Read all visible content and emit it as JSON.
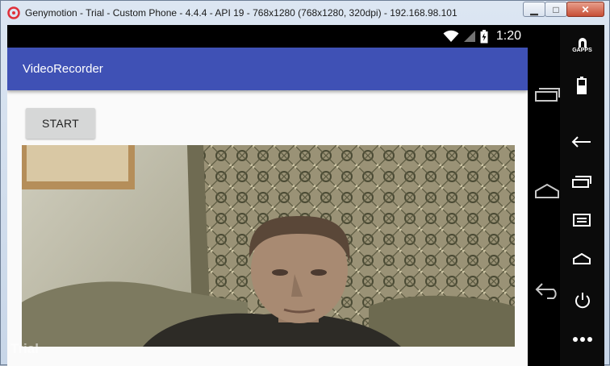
{
  "window": {
    "title": "Genymotion - Trial - Custom Phone - 4.4.4 - API 19 - 768x1280 (768x1280, 320dpi) - 192.168.98.101",
    "minimize_label": "▁",
    "maximize_label": "□",
    "close_label": "✕"
  },
  "statusbar": {
    "time": "1:20",
    "icons": [
      "wifi-icon",
      "signal-icon",
      "battery-icon"
    ]
  },
  "app": {
    "title": "VideoRecorder",
    "start_label": "START"
  },
  "watermark": "Trial",
  "sidebar": {
    "gapps_label": "GAPPS",
    "items": [
      "gapps-icon",
      "battery-icon",
      "back-icon",
      "recent-apps-icon",
      "menu-icon",
      "home-icon",
      "power-icon",
      "more-icon"
    ]
  },
  "navbar": {
    "items": [
      "recent-apps-icon",
      "home-icon",
      "back-icon"
    ]
  },
  "colors": {
    "appbar": "#3f51b5",
    "close": "#c74f36"
  }
}
